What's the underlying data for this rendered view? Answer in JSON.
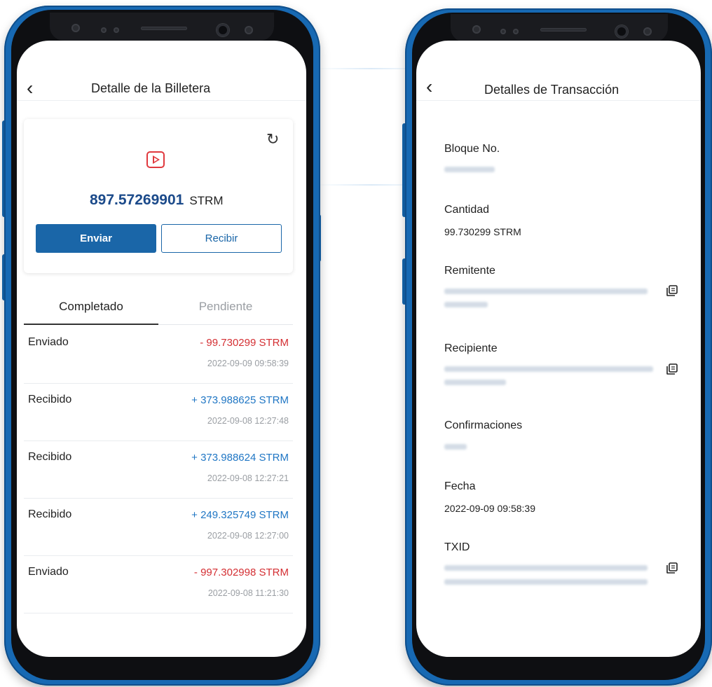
{
  "wallet_screen": {
    "title": "Detalle de la Billetera",
    "balance_amount": "897.57269901",
    "balance_unit": "STRM",
    "send_label": "Enviar",
    "receive_label": "Recibir",
    "tabs": [
      {
        "label": "Completado"
      },
      {
        "label": "Pendiente"
      }
    ],
    "transactions": [
      {
        "type": "Enviado",
        "amount": "- 99.730299 STRM",
        "date": "2022-09-09 09:58:39",
        "direction": "out"
      },
      {
        "type": "Recibido",
        "amount": "+ 373.988625 STRM",
        "date": "2022-09-08 12:27:48",
        "direction": "in"
      },
      {
        "type": "Recibido",
        "amount": "+ 373.988624 STRM",
        "date": "2022-09-08 12:27:21",
        "direction": "in"
      },
      {
        "type": "Recibido",
        "amount": "+ 249.325749 STRM",
        "date": "2022-09-08 12:27:00",
        "direction": "in"
      },
      {
        "type": "Enviado",
        "amount": "- 997.302998 STRM",
        "date": "2022-09-08 11:21:30",
        "direction": "out"
      }
    ]
  },
  "detail_screen": {
    "title": "Detalles de Transacción",
    "block_label": "Bloque No.",
    "amount_label": "Cantidad",
    "amount_value": "99.730299 STRM",
    "sender_label": "Remitente",
    "recipient_label": "Recipiente",
    "confirmations_label": "Confirmaciones",
    "date_label": "Fecha",
    "date_value": "2022-09-09 09:58:39",
    "txid_label": "TXID"
  },
  "colors": {
    "phone_frame": "#1769b3",
    "primary": "#1a66a8",
    "negative": "#d42f33",
    "positive": "#1f76c4",
    "balance": "#1b4a8a"
  }
}
